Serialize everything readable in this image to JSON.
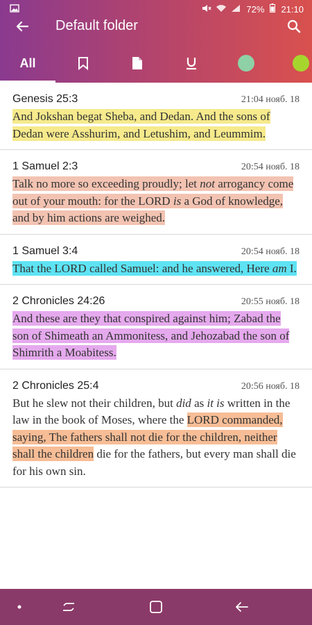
{
  "status_bar": {
    "battery_percent": "72%",
    "time": "21:10"
  },
  "toolbar": {
    "title": "Default folder"
  },
  "tabs": {
    "all_label": "All",
    "colors": {
      "green": "#8fd1a6",
      "lime": "#a6d62e"
    }
  },
  "entries": [
    {
      "reference": "Genesis 25:3",
      "time": "21:04 нояб. 18",
      "segments": [
        {
          "text": "And Jokshan begat Sheba, and Dedan. And the sons of Dedan were Asshurim, and Letushim, and Leummim.",
          "hl": "yellow"
        }
      ]
    },
    {
      "reference": "1 Samuel 2:3",
      "time": "20:54 нояб. 18",
      "segments": [
        {
          "text": "Talk no more so exceeding proudly; let ",
          "hl": "salmon"
        },
        {
          "text": "not",
          "hl": "salmon",
          "italic": true
        },
        {
          "text": " arrogancy come out of your mouth: for the LORD ",
          "hl": "salmon"
        },
        {
          "text": "is",
          "hl": "salmon",
          "italic": true
        },
        {
          "text": " a God of knowledge, and by him actions are weighed.",
          "hl": "salmon"
        }
      ]
    },
    {
      "reference": "1 Samuel 3:4",
      "time": "20:54 нояб. 18",
      "segments": [
        {
          "text": "That the LORD called Samuel: and he answered, Here ",
          "hl": "cyan"
        },
        {
          "text": "am",
          "hl": "cyan",
          "italic": true
        },
        {
          "text": " I.",
          "hl": "cyan"
        }
      ]
    },
    {
      "reference": "2 Chronicles 24:26",
      "time": "20:55 нояб. 18",
      "segments": [
        {
          "text": "And these are they that conspired against him; Zabad the son of Shimeath an Ammonitess, and Jehozabad the son of Shimrith a Moabitess.",
          "hl": "violet"
        }
      ]
    },
    {
      "reference": "2 Chronicles 25:4",
      "time": "20:56 нояб. 18",
      "segments": [
        {
          "text": "But he slew not their children, but ",
          "hl": ""
        },
        {
          "text": "did",
          "hl": "",
          "italic": true
        },
        {
          "text": " as ",
          "hl": ""
        },
        {
          "text": "it is",
          "hl": "",
          "italic": true
        },
        {
          "text": " written in the law in the book of Moses, where the ",
          "hl": ""
        },
        {
          "text": "LORD commanded, saying, The fathers shall not die for the children, neither shall the children",
          "hl": "orange"
        },
        {
          "text": " die for the fathers, but every man shall die for his own sin.",
          "hl": ""
        }
      ]
    }
  ]
}
